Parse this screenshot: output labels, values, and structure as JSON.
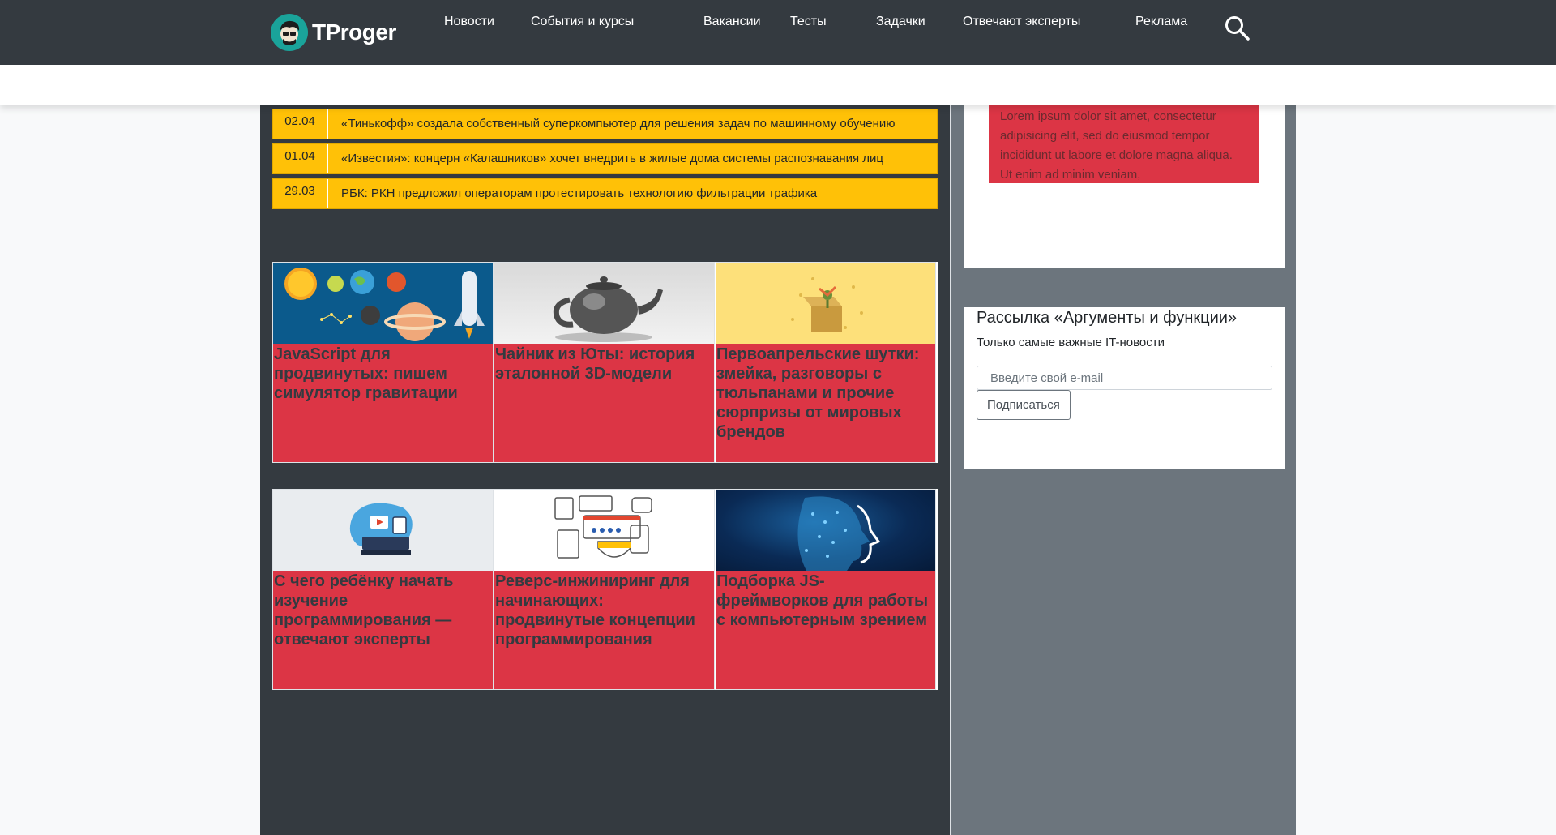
{
  "header": {
    "logo_text": "TProger",
    "nav": [
      {
        "label": "Новости"
      },
      {
        "label": "События и курсы"
      },
      {
        "label": "Вакансии"
      },
      {
        "label": "Тесты"
      },
      {
        "label": "Задачки"
      },
      {
        "label": "Отвечают эксперты"
      },
      {
        "label": "Реклама"
      }
    ],
    "search_icon": "search-icon"
  },
  "news": [
    {
      "date": "02.04",
      "title": "«Тинькофф» создала собственный суперкомпьютер для решения задач по машинному обучению"
    },
    {
      "date": "01.04",
      "title": "«Известия»: концерн «Калашников» хочет внедрить в жилые дома системы распознавания лиц"
    },
    {
      "date": "29.03",
      "title": "РБК: РКН предложил операторам протестировать технологию фильтрации трафика"
    }
  ],
  "cards_row1": [
    {
      "title": "JavaScript для продвинутых: пишем симулятор гравитации",
      "image": "space-illustration"
    },
    {
      "title": "Чайник из Юты: история эталонной 3D-модели",
      "image": "teapot-render"
    },
    {
      "title": "Первоапрельские шутки: змейка, разговоры с тюльпанами и прочие сюрпризы от мировых брендов",
      "image": "surprise-box-illustration"
    }
  ],
  "cards_row2": [
    {
      "title": "С чего ребёнку начать изучение программирования — отвечают эксперты",
      "image": "kid-learning-illustration"
    },
    {
      "title": "Реверс-инжиниринг для начинающих: продвинутые концепции программирования",
      "image": "security-line-illustration"
    },
    {
      "title": "Подборка JS-фреймворков для работы с компьютерным зрением",
      "image": "digital-head-illustration"
    }
  ],
  "sidebar": {
    "lorem": "Lorem ipsum dolor sit amet, consectetur adipisicing elit, sed do eiusmod tempor incididunt ut labore et dolore magna aliqua. Ut enim ad minim veniam,",
    "newsletter": {
      "title": "Рассылка «Аргументы и функции»",
      "subtitle": "Только самые важные IT-новости",
      "placeholder": "Введите свой e-mail",
      "button": "Подписаться"
    }
  },
  "colors": {
    "header_bg": "#343a40",
    "accent_yellow": "#ffc107",
    "accent_red": "#dc3545",
    "logo_teal": "#1aa39a"
  }
}
